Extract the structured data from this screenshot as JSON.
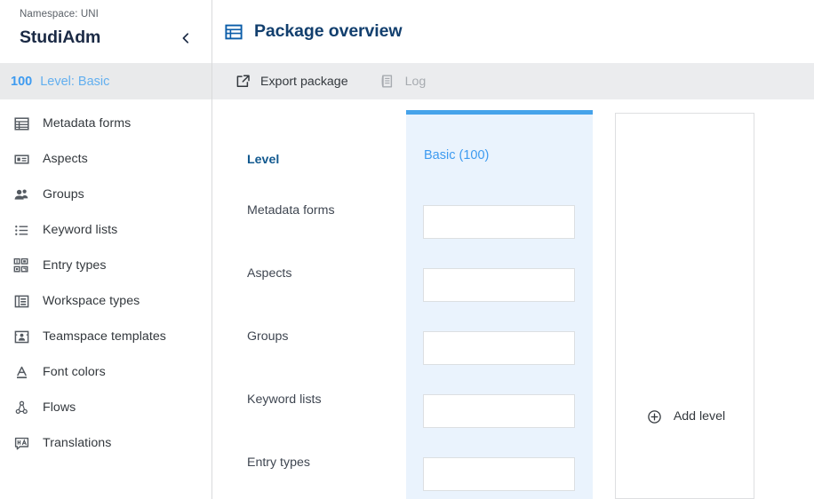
{
  "sidebar": {
    "namespace": "Namespace: UNI",
    "app_title": "StudiAdm",
    "collapse_icon": "chevron-left-icon",
    "active_entry": {
      "code": "100",
      "label": "Level: Basic"
    },
    "items": [
      {
        "label": "Metadata forms",
        "icon": "table-form-icon"
      },
      {
        "label": "Aspects",
        "icon": "aspect-card-icon"
      },
      {
        "label": "Groups",
        "icon": "people-group-icon"
      },
      {
        "label": "Keyword lists",
        "icon": "bullet-list-icon"
      },
      {
        "label": "Entry types",
        "icon": "entry-types-icon"
      },
      {
        "label": "Workspace types",
        "icon": "workspace-types-icon"
      },
      {
        "label": "Teamspace templates",
        "icon": "teamspace-template-icon"
      },
      {
        "label": "Font colors",
        "icon": "font-color-icon"
      },
      {
        "label": "Flows",
        "icon": "flow-nodes-icon"
      },
      {
        "label": "Translations",
        "icon": "translations-icon"
      }
    ]
  },
  "header": {
    "icon": "table-grid-icon",
    "title": "Package overview"
  },
  "toolbar": {
    "export": {
      "label": "Export package",
      "icon": "external-link-icon",
      "disabled": false
    },
    "log": {
      "label": "Log",
      "icon": "document-log-icon",
      "disabled": true
    }
  },
  "board": {
    "row_header": "Level",
    "rows": [
      {
        "label": "Metadata forms"
      },
      {
        "label": "Aspects"
      },
      {
        "label": "Groups"
      },
      {
        "label": "Keyword lists"
      },
      {
        "label": "Entry types"
      }
    ],
    "level_card": {
      "title": "Basic (100)",
      "accent_color": "#46a3ea",
      "background_color": "#eaf3fd"
    },
    "add_level": {
      "label": "Add level",
      "icon": "plus-circle-icon"
    }
  },
  "colors": {
    "accent_blue": "#46a3ea",
    "title_blue": "#123f6e",
    "link_blue": "#3e9bf0",
    "toolbar_gray": "#ebecee",
    "active_row_gray": "#e9eaeb",
    "card_blue": "#eaf3fd"
  }
}
